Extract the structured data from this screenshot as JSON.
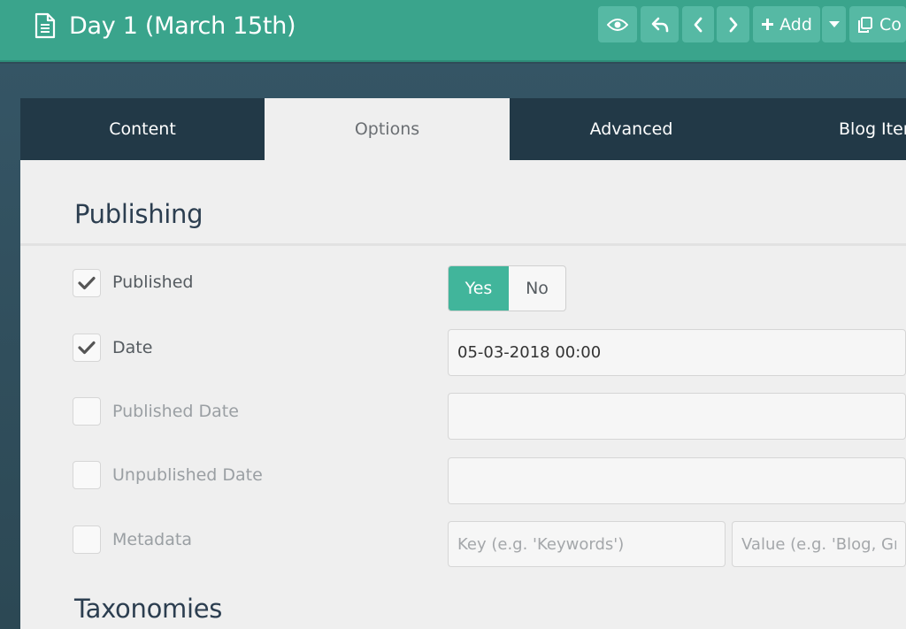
{
  "header": {
    "title": "Day 1 (March 15th)",
    "toolbar": {
      "add_label": "Add",
      "copy_label": "Co"
    }
  },
  "tabs": [
    {
      "label": "Content",
      "active": false
    },
    {
      "label": "Options",
      "active": true
    },
    {
      "label": "Advanced",
      "active": false
    },
    {
      "label": "Blog Item",
      "active": false
    }
  ],
  "sections": {
    "publishing": "Publishing",
    "taxonomies": "Taxonomies"
  },
  "rows": {
    "published": {
      "label": "Published",
      "checked": true,
      "yes": "Yes",
      "no": "No",
      "value": "Yes"
    },
    "date": {
      "label": "Date",
      "checked": true,
      "value": "05-03-2018 00:00"
    },
    "published_date": {
      "label": "Published Date",
      "checked": false,
      "value": ""
    },
    "unpublished_date": {
      "label": "Unpublished Date",
      "checked": false,
      "value": ""
    },
    "metadata": {
      "label": "Metadata",
      "checked": false,
      "key_placeholder": "Key (e.g. 'Keywords')",
      "value_placeholder": "Value (e.g. 'Blog, Grav')"
    }
  },
  "colors": {
    "header_bg": "#3aa48c",
    "toolbar_button": "#56b9a4",
    "tabs_bg": "#223947",
    "toggle_active": "#41b59b"
  }
}
